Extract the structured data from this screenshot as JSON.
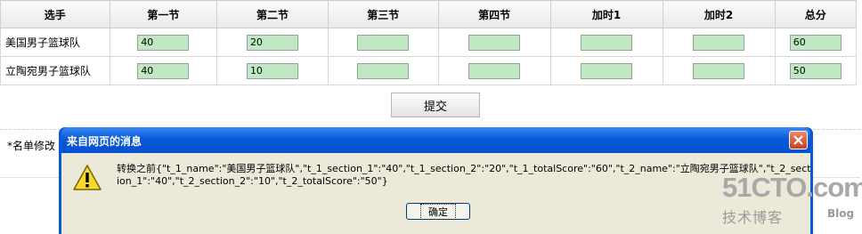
{
  "table": {
    "headers": [
      "选手",
      "第一节",
      "第二节",
      "第三节",
      "第四节",
      "加时1",
      "加时2",
      "总分"
    ],
    "rows": [
      {
        "team": "美国男子篮球队",
        "values": [
          "40",
          "20",
          "",
          "",
          "",
          "",
          "60"
        ]
      },
      {
        "team": "立陶宛男子篮球队",
        "values": [
          "40",
          "10",
          "",
          "",
          "",
          "",
          "50"
        ]
      }
    ]
  },
  "submit_label": "提交",
  "note_text": "*名单修改",
  "dialog": {
    "title": "来自网页的消息",
    "message": "转换之前{\"t_1_name\":\"美国男子篮球队\",\"t_1_section_1\":\"40\",\"t_1_section_2\":\"20\",\"t_1_totalScore\":\"60\",\"t_2_name\":\"立陶宛男子篮球队\",\"t_2_section_1\":\"40\",\"t_2_section_2\":\"10\",\"t_2_totalScore\":\"50\"}",
    "ok_label": "确定",
    "icon": "warning-icon"
  },
  "watermark": {
    "main": "51CTO.com",
    "sub": "技术博客",
    "blog": "Blog"
  },
  "colors": {
    "input_bg": "#bfe8c3",
    "dialog_frame": "#0a5ad8",
    "dialog_body": "#ece9d8"
  }
}
